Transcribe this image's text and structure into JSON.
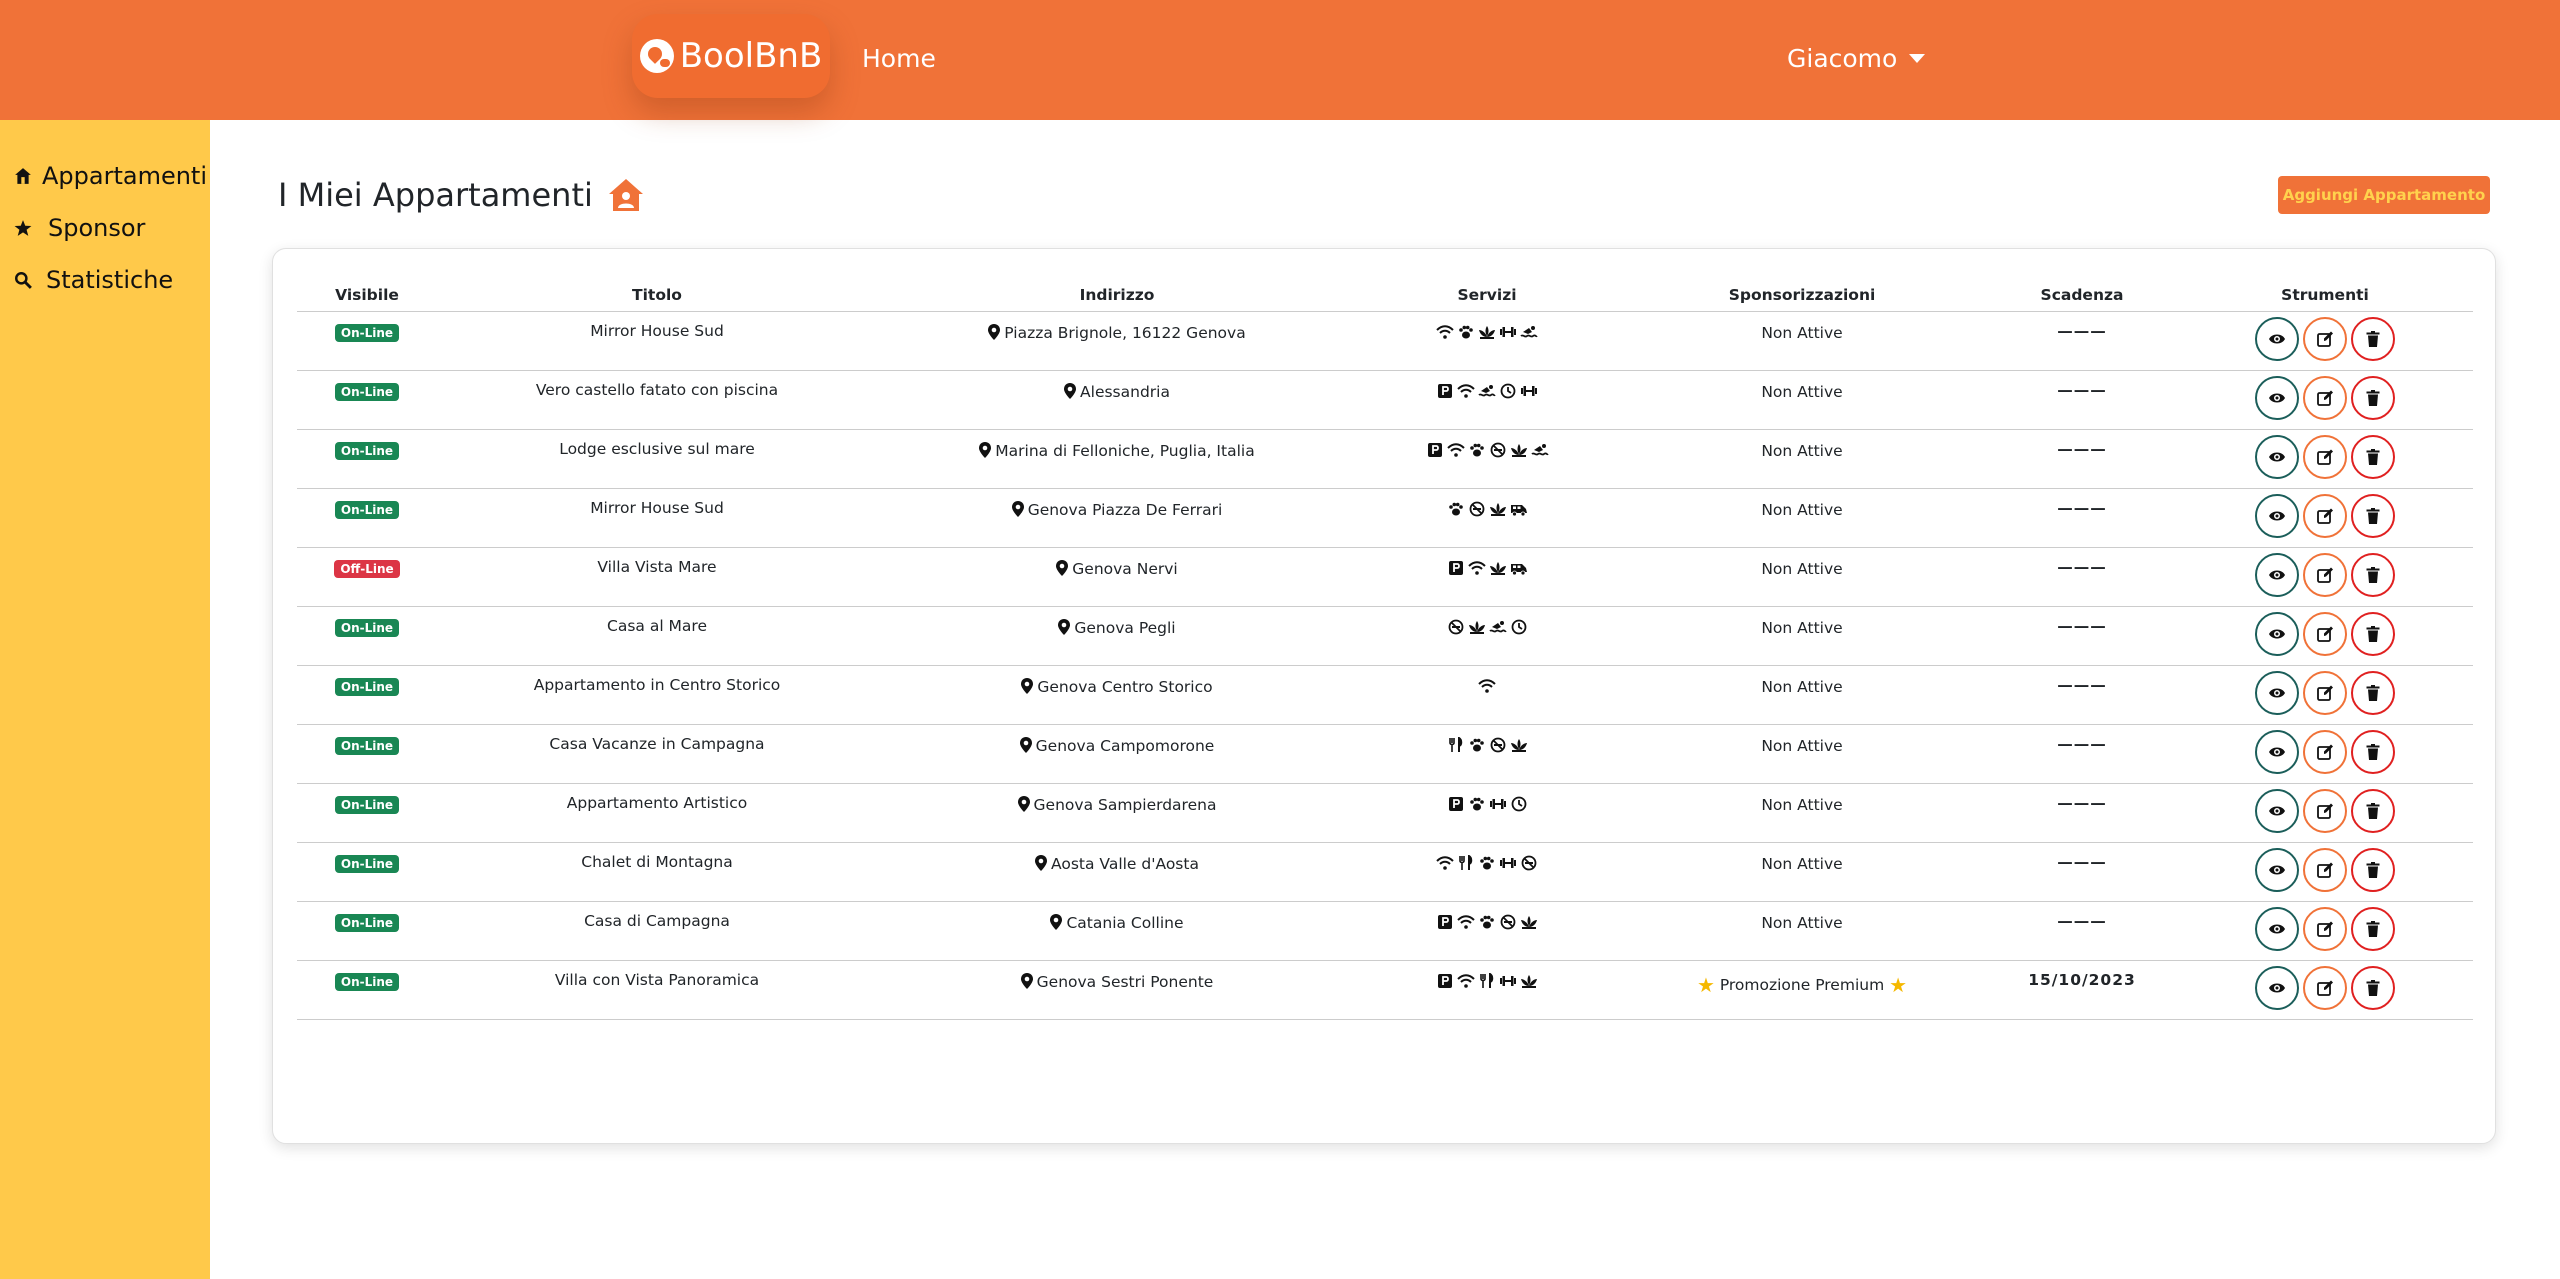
{
  "header": {
    "brand": "BoolBnB",
    "home_label": "Home",
    "user_name": "Giacomo"
  },
  "sidebar": {
    "items": [
      {
        "label": "Appartamenti",
        "icon": "house-icon"
      },
      {
        "label": "Sponsor",
        "icon": "star-icon"
      },
      {
        "label": "Statistiche",
        "icon": "search-icon"
      }
    ]
  },
  "main": {
    "title": "I Miei Appartamenti",
    "title_icon": "house-user-icon",
    "add_button": "Aggiungi Appartamento"
  },
  "table": {
    "columns": [
      "Visibile",
      "Titolo",
      "Indirizzo",
      "Servizi",
      "Sponsorizzazioni",
      "Scadenza",
      "Strumenti"
    ],
    "rows": [
      {
        "status": "On-Line",
        "title": "Mirror House Sud",
        "address": "Piazza Brignole, 16122 Genova",
        "services": [
          "wifi-icon",
          "paw-icon",
          "lotus-icon",
          "dumbbell-icon",
          "swimmer-icon"
        ],
        "sponsor": "Non Attive",
        "expiry": "———"
      },
      {
        "status": "On-Line",
        "title": "Vero castello fatato con piscina",
        "address": "Alessandria",
        "services": [
          "parking-icon",
          "wifi-icon",
          "swimmer-icon",
          "clock-icon",
          "dumbbell-icon"
        ],
        "sponsor": "Non Attive",
        "expiry": "———"
      },
      {
        "status": "On-Line",
        "title": "Lodge esclusive sul mare",
        "address": "Marina di Felloniche, Puglia, Italia",
        "services": [
          "parking-icon",
          "wifi-icon",
          "paw-icon",
          "no-smoking-icon",
          "lotus-icon",
          "swimmer-icon"
        ],
        "sponsor": "Non Attive",
        "expiry": "———"
      },
      {
        "status": "On-Line",
        "title": "Mirror House Sud",
        "address": "Genova Piazza De Ferrari",
        "services": [
          "paw-icon",
          "no-smoking-icon",
          "lotus-icon",
          "van-icon"
        ],
        "sponsor": "Non Attive",
        "expiry": "———"
      },
      {
        "status": "Off-Line",
        "title": "Villa Vista Mare",
        "address": "Genova Nervi",
        "services": [
          "parking-icon",
          "wifi-icon",
          "lotus-icon",
          "van-icon"
        ],
        "sponsor": "Non Attive",
        "expiry": "———"
      },
      {
        "status": "On-Line",
        "title": "Casa al Mare",
        "address": "Genova Pegli",
        "services": [
          "no-smoking-icon",
          "lotus-icon",
          "swimmer-icon",
          "clock-icon"
        ],
        "sponsor": "Non Attive",
        "expiry": "———"
      },
      {
        "status": "On-Line",
        "title": "Appartamento in Centro Storico",
        "address": "Genova Centro Storico",
        "services": [
          "wifi-icon"
        ],
        "sponsor": "Non Attive",
        "expiry": "———"
      },
      {
        "status": "On-Line",
        "title": "Casa Vacanze in Campagna",
        "address": "Genova Campomorone",
        "services": [
          "utensils-icon",
          "paw-icon",
          "no-smoking-icon",
          "lotus-icon"
        ],
        "sponsor": "Non Attive",
        "expiry": "———"
      },
      {
        "status": "On-Line",
        "title": "Appartamento Artistico",
        "address": "Genova Sampierdarena",
        "services": [
          "parking-icon",
          "paw-icon",
          "dumbbell-icon",
          "clock-icon"
        ],
        "sponsor": "Non Attive",
        "expiry": "———"
      },
      {
        "status": "On-Line",
        "title": "Chalet di Montagna",
        "address": "Aosta Valle d'Aosta",
        "services": [
          "wifi-icon",
          "utensils-icon",
          "paw-icon",
          "dumbbell-icon",
          "no-smoking-icon"
        ],
        "sponsor": "Non Attive",
        "expiry": "———"
      },
      {
        "status": "On-Line",
        "title": "Casa di Campagna",
        "address": "Catania Colline",
        "services": [
          "parking-icon",
          "wifi-icon",
          "paw-icon",
          "no-smoking-icon",
          "lotus-icon"
        ],
        "sponsor": "Non Attive",
        "expiry": "———"
      },
      {
        "status": "On-Line",
        "title": "Villa con Vista Panoramica",
        "address": "Genova Sestri Ponente",
        "services": [
          "parking-icon",
          "wifi-icon",
          "utensils-icon",
          "dumbbell-icon",
          "lotus-icon"
        ],
        "sponsor": "Promozione Premium",
        "sponsor_stars": true,
        "expiry": "15/10/2023"
      }
    ]
  },
  "colors": {
    "header": "#f07238",
    "sidebar": "#ffc94a",
    "online": "#198754",
    "offline": "#dc3545",
    "view_border": "#1b5e5a",
    "edit_border": "#f07238",
    "delete_border": "#e02020"
  }
}
